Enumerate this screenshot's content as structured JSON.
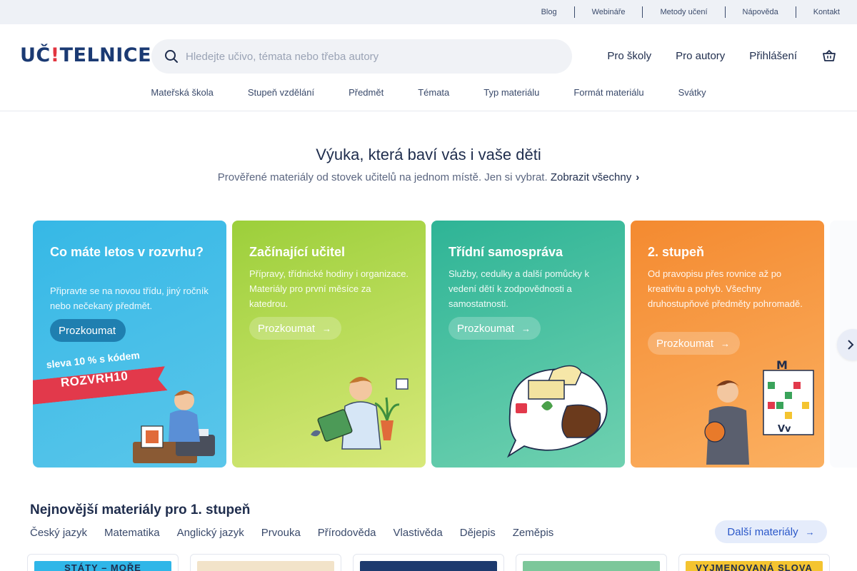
{
  "topbar": {
    "links": [
      "Blog",
      "Webináře",
      "Metody učení",
      "Nápověda",
      "Kontakt"
    ]
  },
  "header": {
    "logo_pre": "UČ",
    "logo_bang": "!",
    "logo_post": "TELNICE",
    "search_placeholder": "Hledejte učivo, témata nebo třeba autory",
    "nav": [
      "Pro školy",
      "Pro autory",
      "Přihlášení"
    ],
    "basket_icon": "basket-icon"
  },
  "categories": [
    "Mateřská škola",
    "Stupeň vzdělání",
    "Předmět",
    "Témata",
    "Typ materiálu",
    "Formát materiálu",
    "Svátky"
  ],
  "hero": {
    "title": "Výuka, která baví vás i vaše děti",
    "subtitle": "Prověřené materiály od stovek učitelů na jednom místě. Jen si vybrat.",
    "show_all": "Zobrazit všechny"
  },
  "cards": [
    {
      "title": "Co máte letos v rozvrhu?",
      "text": "Připravte se na novou třídu, jiný ročník nebo nečekaný předmět.",
      "button": "Prozkoumat",
      "promo_label": "sleva 10 % s kódem",
      "promo_code": "ROZVRH10",
      "color": "#36b8e6"
    },
    {
      "title": "Začínající učitel",
      "text": "Přípravy, třídnické hodiny i organizace. Materiály pro první měsíce za katedrou.",
      "button": "Prozkoumat",
      "color": "#9ccf3a"
    },
    {
      "title": "Třídní samospráva",
      "text": "Služby, cedulky a další pomůcky k vedení dětí k zodpovědnosti a samostatnosti.",
      "button": "Prozkoumat",
      "color": "#2eb496"
    },
    {
      "title": "2. stupeň",
      "text": "Od pravopisu přes rovnice až po kreativitu a pohyb. Všechny druhostupňové předměty pohromadě.",
      "button": "Prozkoumat",
      "color": "#f48a30"
    }
  ],
  "materials": {
    "title": "Nejnovější materiály pro 1. stupeň",
    "subjects": [
      "Český jazyk",
      "Matematika",
      "Anglický jazyk",
      "Prvouka",
      "Přírodověda",
      "Vlastivěda",
      "Dějepis",
      "Zeměpis"
    ],
    "more_button": "Další materiály",
    "thumbs": [
      {
        "text": "STÁTY – MOŘE",
        "color": "#2fb6e8"
      },
      {
        "text": "",
        "color": "#f2e3c9"
      },
      {
        "text": "",
        "color": "#1d3a6e"
      },
      {
        "text": "",
        "color": "#7cc79a"
      },
      {
        "text": "VYJMENOVANÁ SLOVA",
        "color": "#f4c430"
      }
    ]
  },
  "colors": {
    "brand": "#1b3a73",
    "accent": "#e2343f",
    "link_blue": "#2b58c9"
  }
}
